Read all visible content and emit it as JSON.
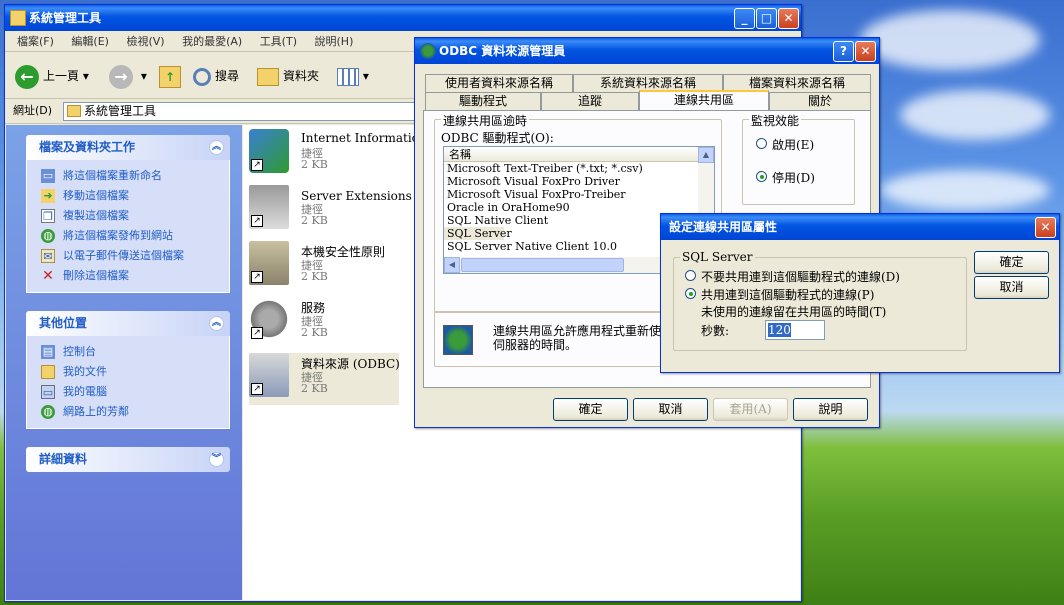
{
  "desktop": {
    "explorer": {
      "title": "系統管理工具",
      "menu": [
        "檔案(F)",
        "編輯(E)",
        "檢視(V)",
        "我的最愛(A)",
        "工具(T)",
        "說明(H)"
      ],
      "toolbar": {
        "back": "上一頁",
        "search": "搜尋",
        "folders": "資料夾"
      },
      "address_label": "網址(D)",
      "address_value": "系統管理工具",
      "tasks": {
        "file_tasks_title": "檔案及資料夾工作",
        "file_tasks": [
          "將這個檔案重新命名",
          "移動這個檔案",
          "複製這個檔案",
          "將這個檔案發佈到網站",
          "以電子郵件傳送這個檔案",
          "刪除這個檔案"
        ],
        "other_places_title": "其他位置",
        "other_places": [
          "控制台",
          "我的文件",
          "我的電腦",
          "網路上的芳鄰"
        ],
        "details_title": "詳細資料"
      },
      "files": [
        {
          "name": "Internet Information Serv",
          "type": "捷徑",
          "size": "2 KB"
        },
        {
          "name": "Server Extensions 管理員",
          "type": "捷徑",
          "size": "2 KB"
        },
        {
          "name": "本機安全性原則",
          "type": "捷徑",
          "size": "2 KB"
        },
        {
          "name": "服務",
          "type": "捷徑",
          "size": "2 KB"
        },
        {
          "name": "資料來源 (ODBC)",
          "type": "捷徑",
          "size": "2 KB"
        }
      ]
    },
    "odbc": {
      "title": "ODBC 資料來源管理員",
      "tabs_row1": [
        "使用者資料來源名稱",
        "系統資料來源名稱",
        "檔案資料來源名稱"
      ],
      "tabs_row2": [
        "驅動程式",
        "追蹤",
        "連線共用區",
        "關於"
      ],
      "timeout_group": "連線共用區逾時",
      "drivers_label": "ODBC 驅動程式(O):",
      "list_header": "名稱",
      "drivers": [
        "Microsoft Text-Treiber (*.txt; *.csv)",
        "Microsoft Visual FoxPro Driver",
        "Microsoft Visual FoxPro-Treiber",
        "Oracle in OraHome90",
        "SQL Native Client",
        "SQL Server",
        "SQL Server Native Client 10.0"
      ],
      "selected_driver": "SQL Server",
      "perf_group": "監視效能",
      "enable": "啟用(E)",
      "disable": "停用(D)",
      "info_text_1": "連線共用區允許應用程式重新使",
      "info_text_2": "伺服器的時間。",
      "buttons": {
        "ok": "確定",
        "cancel": "取消",
        "apply": "套用(A)",
        "help": "說明"
      }
    },
    "pool_dialog": {
      "title": "設定連線共用區屬性",
      "group": "SQL Server",
      "option_no_pool": "不要共用連到這個驅動程式的連線(D)",
      "option_pool": "共用連到這個驅動程式的連線(P)",
      "unused_label": "未使用的連線留在共用區的時間(T)",
      "seconds_label": "秒數:",
      "seconds_value": "120",
      "ok": "確定",
      "cancel": "取消"
    }
  }
}
